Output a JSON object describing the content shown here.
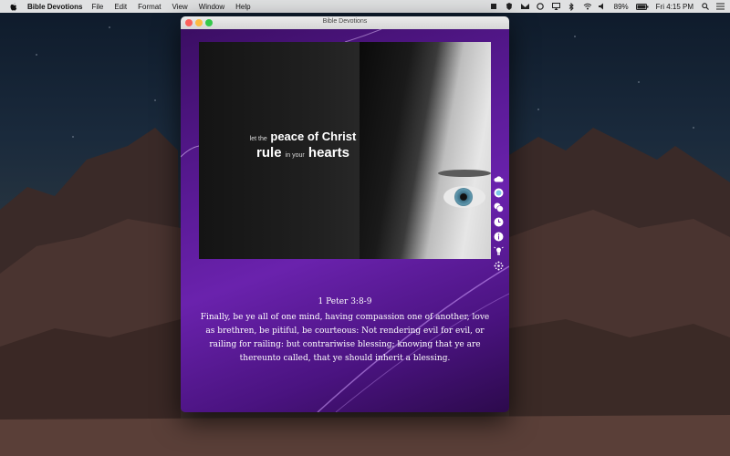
{
  "menubar": {
    "app_name": "Bible Devotions",
    "items": [
      "File",
      "Edit",
      "Format",
      "View",
      "Window",
      "Help"
    ],
    "battery": "89%",
    "clock": "Fri 4:15 PM"
  },
  "window": {
    "title": "Bible Devotions"
  },
  "image_quote": {
    "line1_small": "let the",
    "line1_big": "peace of Christ",
    "line2_big_a": "rule",
    "line2_small": "in your",
    "line2_big_b": "hearts"
  },
  "verse": {
    "reference": "1 Peter 3:8-9",
    "text": "Finally, be ye all of one mind, having compassion one of another, love as brethren, be pitiful, be courteous: Not rendering evil for evil, or railing for railing: but contrariwise blessing; knowing that ye are thereunto called, that ye should inherit a blessing."
  },
  "toolbar_icons": [
    "cloud-icon",
    "globe-icon",
    "chat-icon",
    "clock-icon",
    "info-icon",
    "lightbulb-icon",
    "settings-icon"
  ],
  "colors": {
    "window_purple": "#5a1a96",
    "accent": "#6a22ad"
  }
}
